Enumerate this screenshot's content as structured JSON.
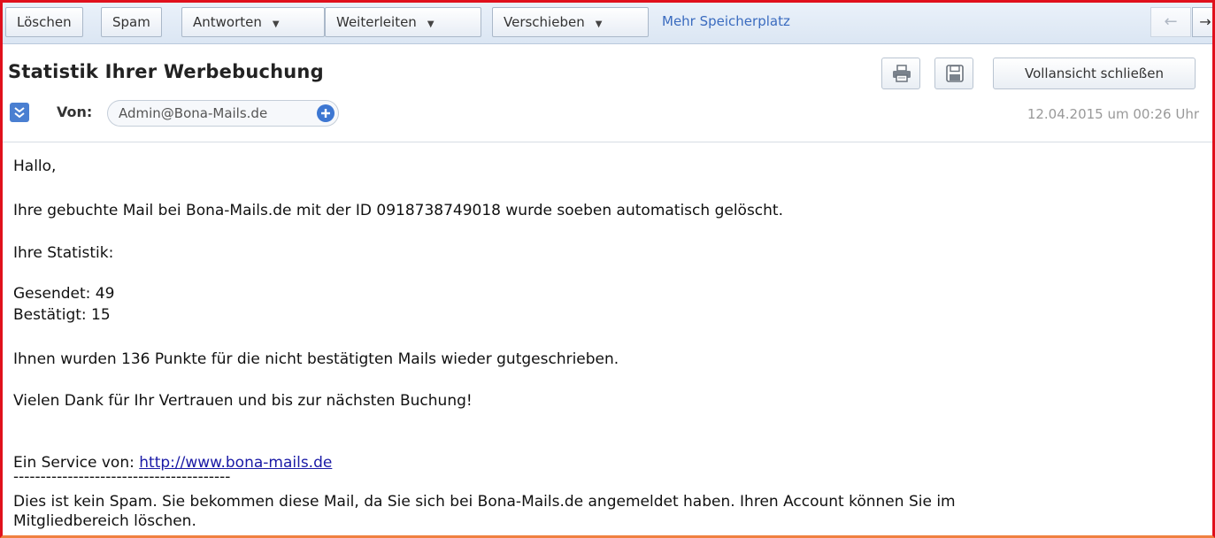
{
  "toolbar": {
    "delete": "Löschen",
    "spam": "Spam",
    "reply": "Antworten",
    "forward": "Weiterleiten",
    "move": "Verschieben",
    "more_storage": "Mehr Speicherplatz",
    "back_arrow": "←",
    "next_partial": "→"
  },
  "header": {
    "subject": "Statistik Ihrer Werbebuchung",
    "print_icon": "printer-icon",
    "save_icon": "floppy-disk-icon",
    "close_full_view": "Vollansicht schließen",
    "from_label": "Von:",
    "sender": "Admin@Bona-Mails.de",
    "date": "12.04.2015 um 00:26 Uhr"
  },
  "body": {
    "greeting": "Hallo,",
    "line1": "Ihre gebuchte Mail bei Bona-Mails.de mit der ID 0918738749018 wurde soeben automatisch gelöscht.",
    "stats_heading": "Ihre Statistik:",
    "sent": "Gesendet: 49",
    "confirmed": "Bestätigt: 15",
    "points": "Ihnen wurden 136 Punkte für die nicht bestätigten Mails wieder gutgeschrieben.",
    "thanks": "Vielen Dank für Ihr Vertrauen und bis zur nächsten Buchung!",
    "service_label": "Ein Service von: ",
    "service_link": "http://www.bona-mails.de",
    "separator": "----------------------------------------",
    "disclaimer_line1": "Dies ist kein Spam. Sie bekommen diese Mail, da Sie sich bei Bona-Mails.de angemeldet haben. Ihren Account können Sie im",
    "disclaimer_line2": "Mitgliedbereich löschen."
  },
  "colors": {
    "frame_border": "#e0101c",
    "link": "#1a1aa6",
    "toolbar_link": "#3a6bbf",
    "accent_blue": "#4a7fd1"
  }
}
